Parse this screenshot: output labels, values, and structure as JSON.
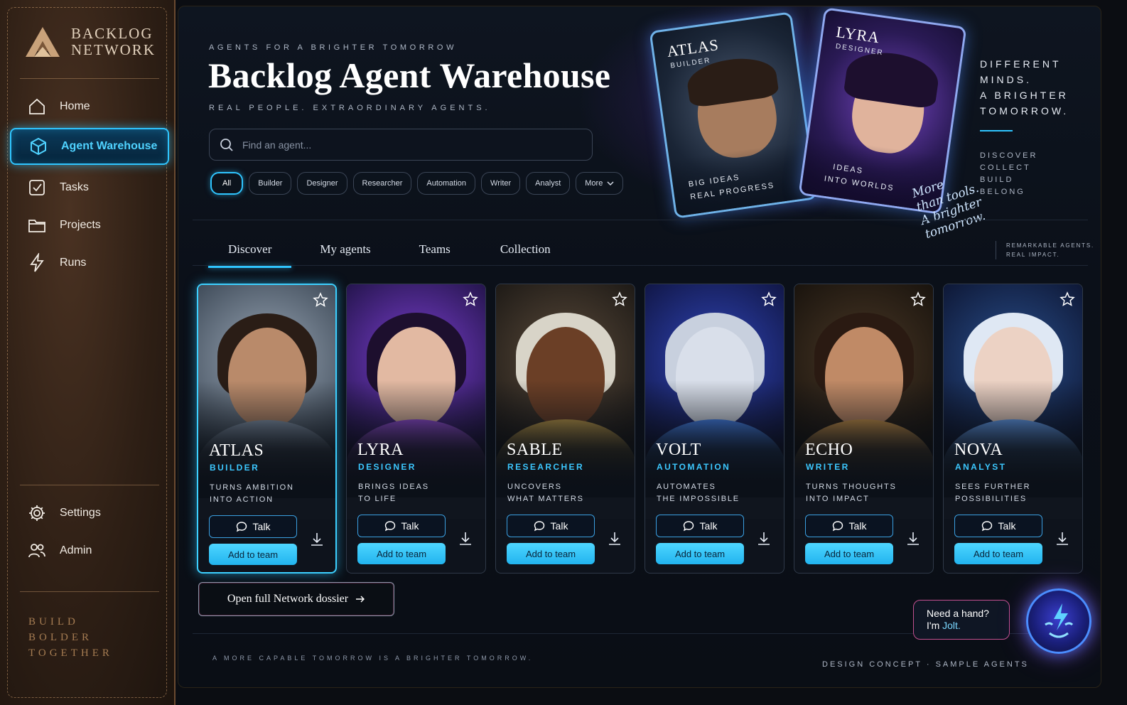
{
  "brand": {
    "line1": "BACKLOG",
    "line2": "NETWORK"
  },
  "sidebar": {
    "items": [
      {
        "label": "Home",
        "icon": "home-icon"
      },
      {
        "label": "Agent Warehouse",
        "icon": "cube-icon",
        "active": true
      },
      {
        "label": "Tasks",
        "icon": "checkbox-icon"
      },
      {
        "label": "Projects",
        "icon": "folder-icon"
      },
      {
        "label": "Runs",
        "icon": "lightning-icon"
      }
    ],
    "bottom_items": [
      {
        "label": "Settings",
        "icon": "gear-icon"
      },
      {
        "label": "Admin",
        "icon": "users-icon"
      }
    ],
    "tagline": [
      "BUILD",
      "BOLDER",
      "TOGETHER"
    ]
  },
  "hero": {
    "eyebrow": "AGENTS FOR A BRIGHTER TOMORROW",
    "title": "Backlog Agent Warehouse",
    "subtitle": "REAL PEOPLE. EXTRAORDINARY AGENTS.",
    "search_placeholder": "Find an agent...",
    "filters": [
      "All",
      "Builder",
      "Designer",
      "Researcher",
      "Automation",
      "Writer",
      "Analyst",
      "More"
    ],
    "cards": [
      {
        "name": "ATLAS",
        "role": "BUILDER",
        "line1": "BIG IDEAS",
        "line2": "REAL PROGRESS"
      },
      {
        "name": "LYRA",
        "role": "DESIGNER",
        "line1": "IDEAS",
        "line2": "INTO WORLDS"
      }
    ],
    "motto": [
      "DIFFERENT",
      "MINDS.",
      "A BRIGHTER",
      "TOMORROW."
    ],
    "motto_list": [
      "DISCOVER",
      "COLLECT",
      "BUILD",
      "BELONG"
    ],
    "script": [
      "More",
      "than tools.",
      "A brighter",
      "tomorrow."
    ],
    "remark": [
      "REMARKABLE AGENTS.",
      "REAL IMPACT."
    ]
  },
  "tabs": [
    "Discover",
    "My agents",
    "Teams",
    "Collection"
  ],
  "agents": [
    {
      "name": "ATLAS",
      "role": "BUILDER",
      "desc1": "TURNS AMBITION",
      "desc2": "INTO ACTION",
      "talk": "Talk",
      "add": "Add to team",
      "accent": "#8a9bb0",
      "skin": "#b98a6a",
      "hairc": "#2a1d16",
      "bg1": "#9aa7b6",
      "bg2": "#3a4654"
    },
    {
      "name": "LYRA",
      "role": "DESIGNER",
      "desc1": "BRINGS IDEAS",
      "desc2": "TO LIFE",
      "talk": "Talk",
      "add": "Add to team",
      "accent": "#9a4fe0",
      "skin": "#e2b9a2",
      "hairc": "#1d0f2e",
      "bg1": "#7b3fd0",
      "bg2": "#1f1245"
    },
    {
      "name": "SABLE",
      "role": "RESEARCHER",
      "desc1": "UNCOVERS",
      "desc2": "WHAT MATTERS",
      "talk": "Talk",
      "add": "Add to team",
      "accent": "#c9a24a",
      "skin": "#6b3f26",
      "hairc": "#d8d4c8",
      "bg1": "#5a4a3a",
      "bg2": "#1a1714"
    },
    {
      "name": "VOLT",
      "role": "AUTOMATION",
      "desc1": "AUTOMATES",
      "desc2": "THE IMPOSSIBLE",
      "talk": "Talk",
      "add": "Add to team",
      "accent": "#4a8cff",
      "skin": "#d9dfea",
      "hairc": "#c8d0de",
      "bg1": "#3045b8",
      "bg2": "#0f1440"
    },
    {
      "name": "ECHO",
      "role": "WRITER",
      "desc1": "TURNS THOUGHTS",
      "desc2": "INTO IMPACT",
      "talk": "Talk",
      "add": "Add to team",
      "accent": "#d49a4a",
      "skin": "#c08a66",
      "hairc": "#2a1a12",
      "bg1": "#4a3826",
      "bg2": "#16110c"
    },
    {
      "name": "NOVA",
      "role": "ANALYST",
      "desc1": "SEES FURTHER",
      "desc2": "POSSIBILITIES",
      "talk": "Talk",
      "add": "Add to team",
      "accent": "#6aa8ff",
      "skin": "#ecd2c4",
      "hairc": "#dfe8f4",
      "bg1": "#2a4f8c",
      "bg2": "#0c1430"
    }
  ],
  "dossier": "Open full Network dossier",
  "footer_left": "A MORE CAPABLE TOMORROW IS A BRIGHTER TOMORROW.",
  "footer_right": "DESIGN CONCEPT · SAMPLE AGENTS",
  "assistant": {
    "line1": "Need a hand?",
    "line2_prefix": "I'm ",
    "line2_name": "Jolt."
  },
  "colors": {
    "accent": "#2fc5ff",
    "leather": "#3a281b",
    "add_button": "#3ccbff"
  }
}
